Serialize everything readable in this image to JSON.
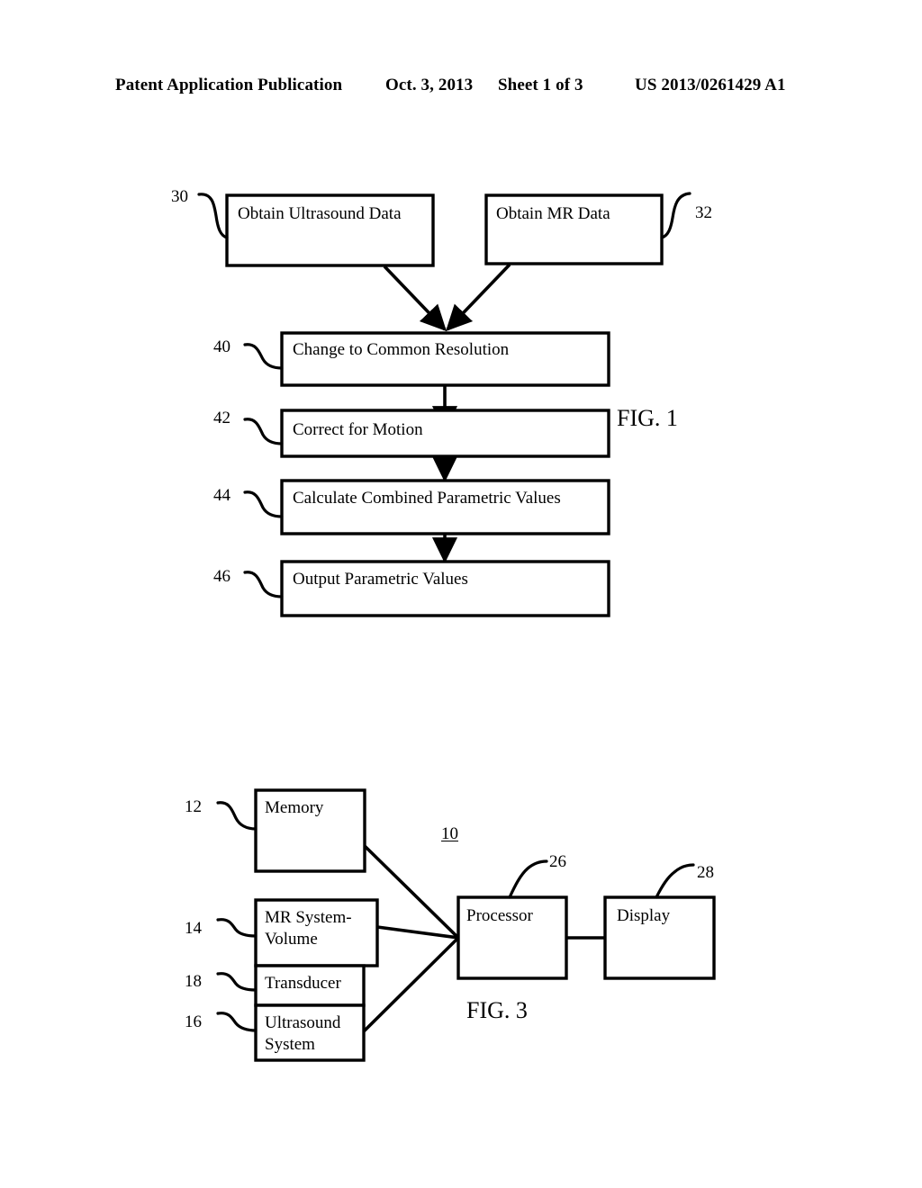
{
  "header": {
    "publication": "Patent Application Publication",
    "date": "Oct. 3, 2013",
    "sheet": "Sheet 1 of 3",
    "patent_number": "US 2013/0261429 A1"
  },
  "figures": [
    {
      "caption": "FIG. 1",
      "type": "flowchart",
      "boxes": [
        {
          "ref": "30",
          "label": "Obtain Ultrasound Data"
        },
        {
          "ref": "32",
          "label": "Obtain MR Data"
        },
        {
          "ref": "40",
          "label": "Change to Common Resolution"
        },
        {
          "ref": "42",
          "label": "Correct for Motion"
        },
        {
          "ref": "44",
          "label": "Calculate Combined Parametric Values"
        },
        {
          "ref": "46",
          "label": "Output Parametric Values"
        }
      ]
    },
    {
      "caption": "FIG. 3",
      "type": "block-diagram",
      "system_ref": "10",
      "boxes": [
        {
          "ref": "12",
          "label": "Memory"
        },
        {
          "ref": "14",
          "label": "MR System-\nVolume"
        },
        {
          "ref": "18",
          "label": "Transducer"
        },
        {
          "ref": "16",
          "label": "Ultrasound\nSystem"
        },
        {
          "ref": "26",
          "label": "Processor"
        },
        {
          "ref": "28",
          "label": "Display"
        }
      ]
    }
  ],
  "colors": {
    "ink": "#000000",
    "page": "#ffffff"
  }
}
